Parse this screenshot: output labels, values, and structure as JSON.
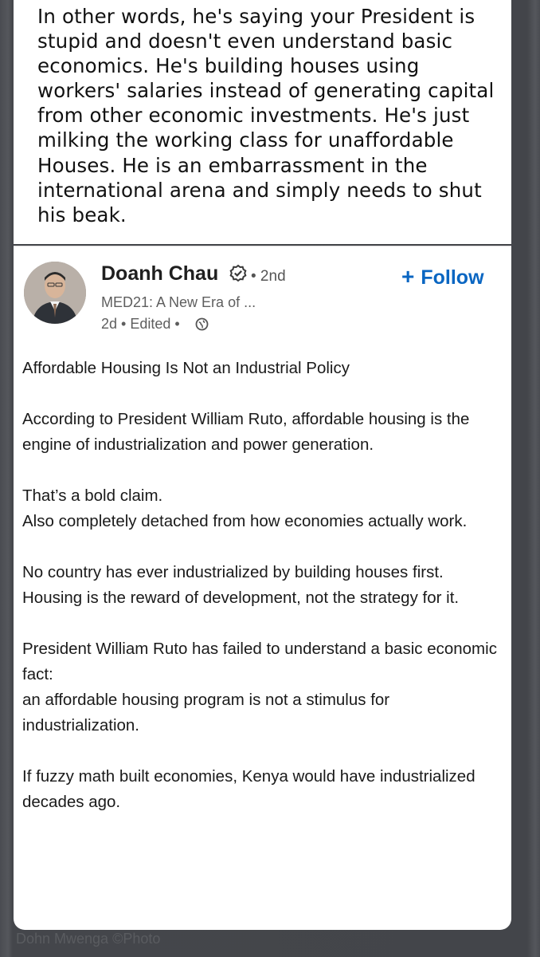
{
  "caption": "In other words, he's saying your President is stupid and doesn't even understand basic economics. He's building houses using workers' salaries instead of generating capital from other economic investments. He's just milking the working class for unaffordable Houses. He is an embarrassment in the international arena and simply needs to shut his beak.",
  "post": {
    "author": "Doanh Chau",
    "degree": "• 2nd",
    "headline": "MED21: A New Era of ...",
    "meta": "2d • Edited •",
    "follow_label": "Follow",
    "paragraphs": [
      "Affordable Housing Is Not an Industrial Policy",
      "According to President William Ruto, affordable housing is the engine of industrialization and power generation.",
      "That’s a bold claim.\nAlso completely detached from how economies actually work.",
      "No country has ever industrialized by building houses first.\nHousing is the reward of development, not the strategy for it.",
      "President William Ruto has failed to understand a basic economic fact:\nan affordable housing program is not a stimulus for industrialization.",
      "If fuzzy math built economies, Kenya would have industrialized decades ago."
    ]
  },
  "background_text": "Dohn Mwenga ©Photo",
  "colors": {
    "accent": "#0a66c2",
    "card": "#ffffff",
    "backdrop": "#44464b"
  }
}
